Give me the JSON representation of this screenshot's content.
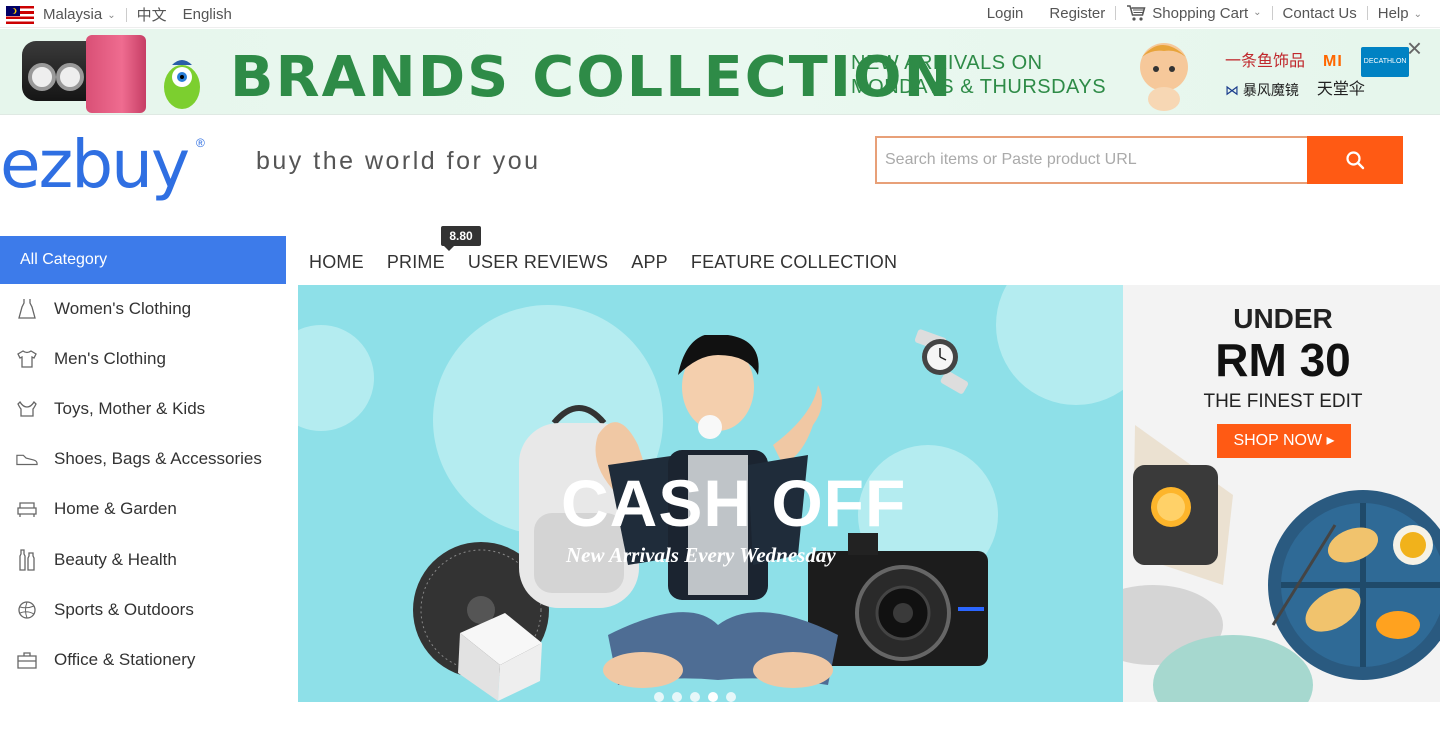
{
  "topbar": {
    "country": "Malaysia",
    "lang_zh": "中文",
    "lang_en": "English",
    "login": "Login",
    "register": "Register",
    "cart": "Shopping Cart",
    "contact": "Contact Us",
    "help": "Help"
  },
  "promo": {
    "title": "BRANDS COLLECTION",
    "sub_line1": "NEW ARRIVALS ON",
    "sub_line2": "MONDAYS & THURSDAYS",
    "brand1": "一条鱼饰品",
    "brand2": "MI",
    "brand3": "DECATHLON",
    "brand4": "暴风魔镜",
    "brand5": "天堂伞",
    "close": "×"
  },
  "header": {
    "logo": "ezbuy",
    "logo_mark": "®",
    "slogan": "buy the world for you",
    "search_placeholder": "Search items or Paste product URL"
  },
  "nav": {
    "all_category": "All Category",
    "items": [
      "HOME",
      "PRIME",
      "USER REVIEWS",
      "APP",
      "FEATURE COLLECTION"
    ],
    "badge": "8.80"
  },
  "sidebar": {
    "items": [
      {
        "label": "Women's Clothing",
        "icon": "dress-icon"
      },
      {
        "label": "Men's Clothing",
        "icon": "tshirt-icon"
      },
      {
        "label": "Toys, Mother & Kids",
        "icon": "bib-icon"
      },
      {
        "label": "Shoes, Bags & Accessories",
        "icon": "shoe-icon"
      },
      {
        "label": "Home & Garden",
        "icon": "sofa-icon"
      },
      {
        "label": "Beauty & Health",
        "icon": "bottles-icon"
      },
      {
        "label": "Sports & Outdoors",
        "icon": "ball-icon"
      },
      {
        "label": "Office & Stationery",
        "icon": "briefcase-icon"
      }
    ]
  },
  "hero": {
    "title": "CASH OFF",
    "subtitle": "New Arrivals Every Wednesday",
    "slides": 5,
    "active_slide": 4
  },
  "side_ad": {
    "line1": "UNDER",
    "line2": "RM 30",
    "line3": "THE FINEST EDIT",
    "cta": "SHOP NOW"
  },
  "colors": {
    "accent_orange": "#ff5a14",
    "brand_blue": "#2f6fe2",
    "category_blue": "#3d7bea",
    "promo_green": "#2e8b47",
    "hero_cyan": "#8ee0e8"
  }
}
